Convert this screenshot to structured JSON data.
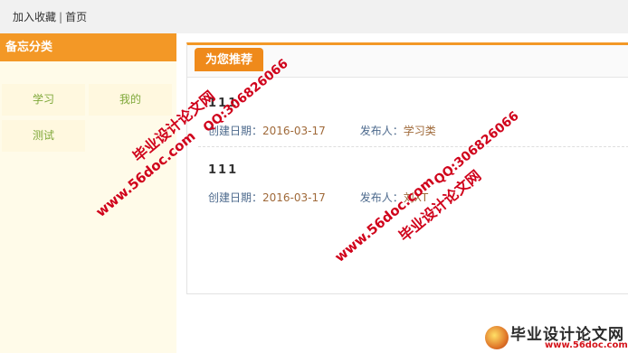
{
  "topbar": {
    "favorite": "加入收藏",
    "separator": "|",
    "home": "首页"
  },
  "sidebar": {
    "title": "备忘分类",
    "categories": [
      "学习",
      "我的",
      "测试"
    ]
  },
  "panel": {
    "tab": "为您推荐"
  },
  "items": [
    {
      "title": "111",
      "date_label": "创建日期：",
      "date": "2016-03-17",
      "publisher_label": "发布人：",
      "publisher": "学习类"
    },
    {
      "title": "111",
      "date_label": "创建日期：",
      "date": "2016-03-17",
      "publisher_label": "发布人：",
      "publisher": "刘XT"
    }
  ],
  "watermarks": {
    "site_name": "毕业设计论文网",
    "qq": "QQ:306826066",
    "url": "www.56doc.com"
  },
  "footer_logo": {
    "name": "毕业设计论文网",
    "url": "www.56doc.com"
  },
  "colors": {
    "accent": "#f39826",
    "watermark": "#d0021b"
  }
}
